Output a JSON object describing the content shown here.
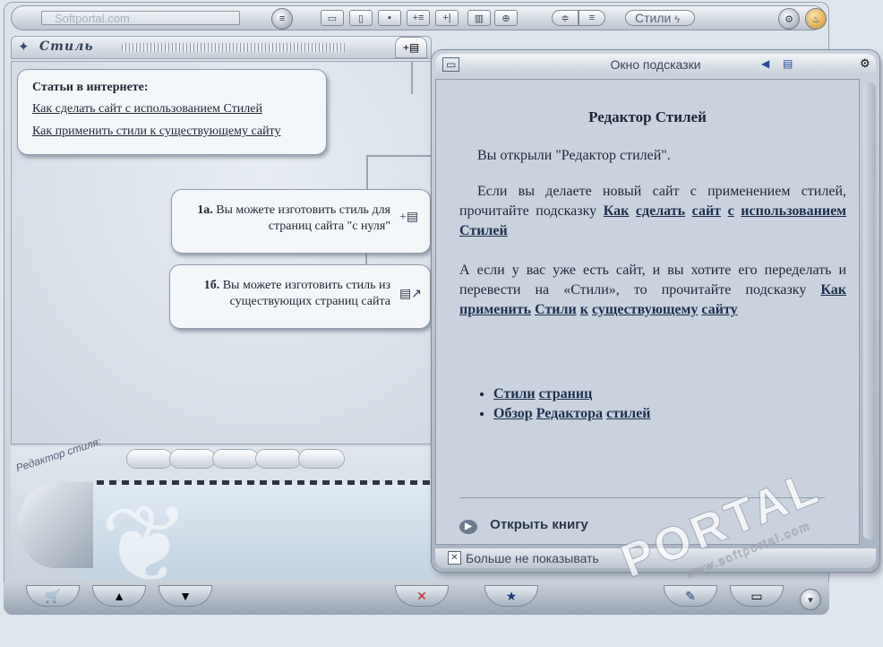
{
  "toolbar": {
    "address_value": "Softportal.com",
    "style_button_label": "Стили"
  },
  "header": {
    "title": "Стиль"
  },
  "articles": {
    "heading": "Статьи в интернете:",
    "links": [
      "Как сделать сайт с использованием Стилей",
      "Как применить стили к существующему сайту"
    ]
  },
  "options": [
    {
      "num": "1а.",
      "text": "Вы можете изготовить стиль для страниц сайта \"с нуля\""
    },
    {
      "num": "1б.",
      "text": "Вы можете изготовить стиль из существующих страниц сайта"
    }
  ],
  "editor": {
    "label": "Редактор стиля:"
  },
  "hint": {
    "window_title": "Окно подсказки",
    "heading": "Редактор Стилей",
    "p1": "Вы открыли \"Редактор стилей\".",
    "p2_text": "Если вы делаете новый сайт с применением стилей, прочитайте подсказку",
    "p2_links": [
      "Как",
      "сделать",
      "сайт",
      "с",
      "использованием",
      "Стилей"
    ],
    "p3_text": "А если у вас уже есть сайт, и вы хотите его переделать и перевести на «Стили», то прочитайте подсказку",
    "p3_links": [
      "Как",
      "применить",
      "Стили",
      "к",
      "существующему",
      "сайту"
    ],
    "bullets": [
      [
        "Стили",
        "страниц"
      ],
      [
        "Обзор",
        "Редактора",
        "стилей"
      ]
    ],
    "open_book": "Открыть книгу",
    "dont_show": "Больше не показывать"
  },
  "watermark": {
    "text": "PORTAL",
    "url": "www.softportal.com"
  }
}
